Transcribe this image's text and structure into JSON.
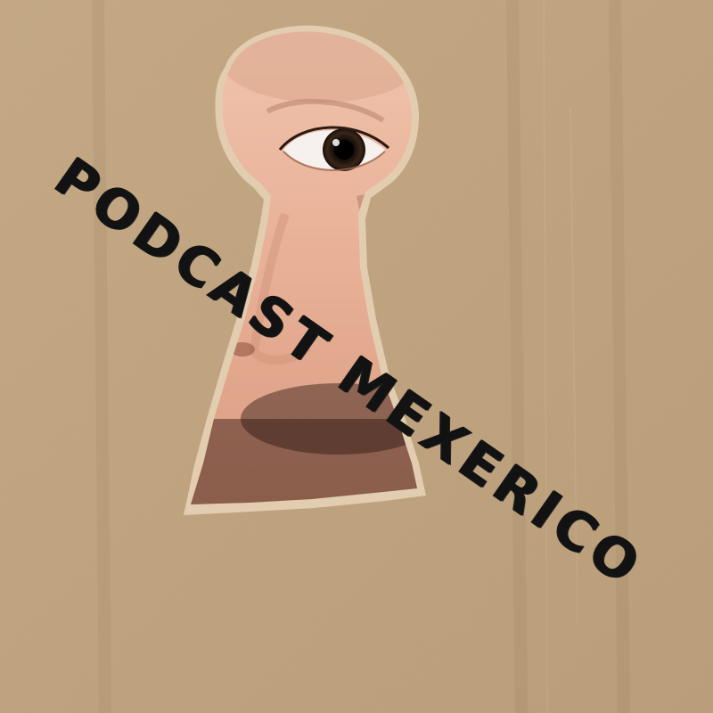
{
  "title": "PODCAST MEXERICO",
  "colors": {
    "cardboard": "#c4a884",
    "cardboard_light": "#d2b995",
    "skin": "#e8b59c",
    "text": "#121212"
  }
}
